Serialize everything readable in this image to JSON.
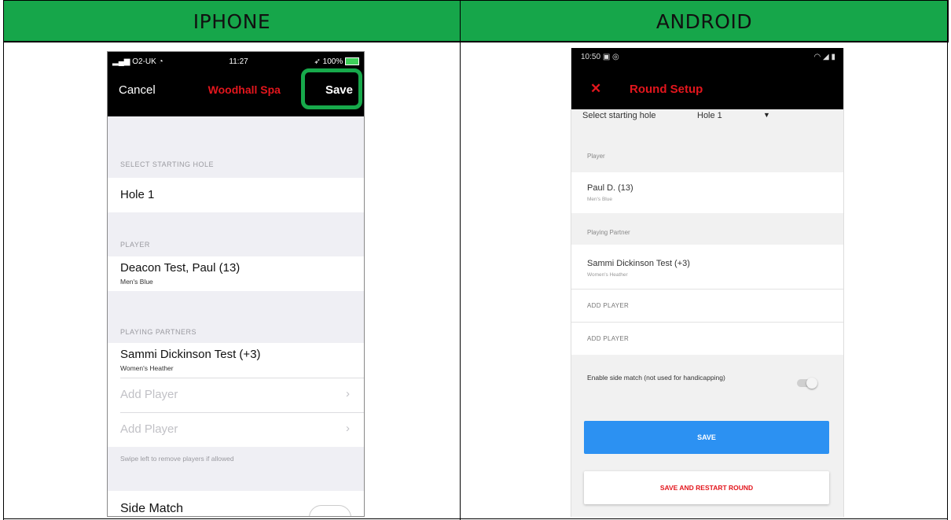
{
  "headers": {
    "left": "IPHONE",
    "right": "ANDROID"
  },
  "iphone": {
    "status": {
      "carrier": "O2-UK",
      "time": "11:27",
      "battery": "100%"
    },
    "nav": {
      "cancel": "Cancel",
      "title": "Woodhall Spa",
      "save": "Save"
    },
    "starting_hole": {
      "section": "SELECT STARTING HOLE",
      "value": "Hole 1"
    },
    "player": {
      "section": "PLAYER",
      "name": "Deacon Test, Paul (13)",
      "tee": "Men's Blue"
    },
    "partners": {
      "section": "PLAYING PARTNERS",
      "name": "Sammi Dickinson Test (+3)",
      "tee": "Women's Heather",
      "add_1": "Add Player",
      "add_2": "Add Player",
      "hint": "Swipe left to remove players if allowed"
    },
    "side_match": "Side Match"
  },
  "android": {
    "status": {
      "time": "10:50"
    },
    "title": "Round Setup",
    "starting_hole": {
      "label": "Select starting hole",
      "value": "Hole 1"
    },
    "player": {
      "section": "Player",
      "name": "Paul D. (13)",
      "tee": "Men's Blue"
    },
    "partner": {
      "section": "Playing Partner",
      "name": "Sammi Dickinson Test (+3)",
      "tee": "Women's Heather"
    },
    "add_1": "ADD PLAYER",
    "add_2": "ADD PLAYER",
    "side_match": "Enable side match (not used for handicapping)",
    "save": "SAVE",
    "save_restart": "SAVE AND RESTART ROUND"
  }
}
